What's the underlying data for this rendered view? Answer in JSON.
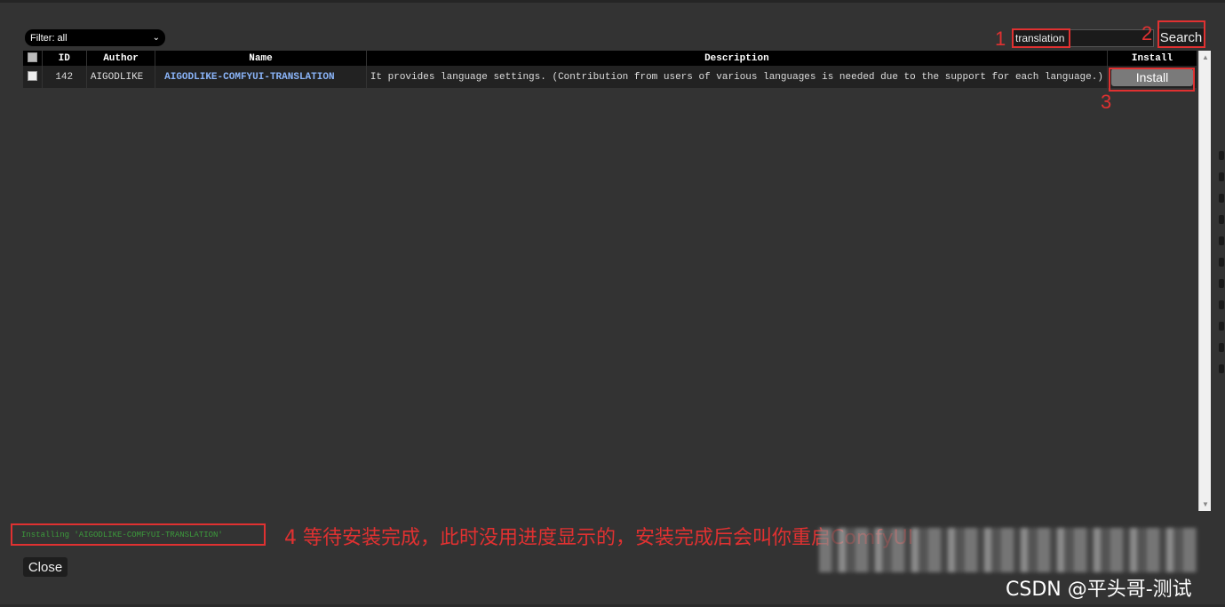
{
  "toolbar": {
    "filter_label": "Filter: all",
    "search_value": "translation",
    "search_button": "Search"
  },
  "annotations": {
    "step1": "1",
    "step2": "2",
    "step3": "3",
    "step4_text": "4 等待安装完成，此时没用进度显示的，安装完成后会叫你重启ComfyUI"
  },
  "table": {
    "headers": [
      "ID",
      "Author",
      "Name",
      "Description",
      "Install"
    ],
    "rows": [
      {
        "id": "142",
        "author": "AIGODLIKE",
        "name": "AIGODLIKE-COMFYUI-TRANSLATION",
        "description": "It provides language settings. (Contribution from users of various languages is needed due to the support for each language.)",
        "install_label": "Install"
      }
    ]
  },
  "status": {
    "message": "Installing 'AIGODLIKE-COMFYUI-TRANSLATION'"
  },
  "footer": {
    "close_label": "Close"
  },
  "watermark": "CSDN @平头哥-测试",
  "colors": {
    "annotation_red": "#e03131",
    "link_blue": "#8ab4f8",
    "status_green": "#3c9a3c"
  }
}
